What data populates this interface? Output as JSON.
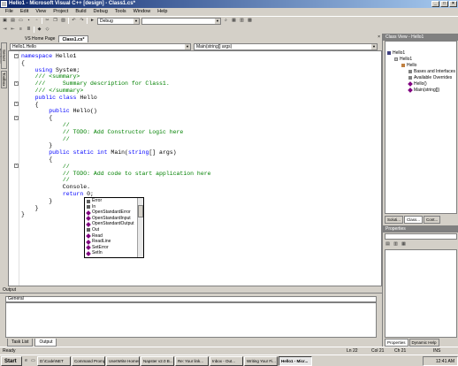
{
  "window": {
    "title": "Hello1 - Microsoft Visual C++ [design] - Class1.cs*",
    "min": "_",
    "max": "□",
    "close": "×"
  },
  "menu": [
    "File",
    "Edit",
    "View",
    "Project",
    "Build",
    "Debug",
    "Tools",
    "Window",
    "Help"
  ],
  "toolbar": {
    "config": "Debug"
  },
  "left_tabs": [
    "Server Explorer",
    "Toolbox"
  ],
  "doc_tabs": [
    {
      "label": "VS Home Page",
      "active": false
    },
    {
      "label": "Class1.cs*",
      "active": true
    }
  ],
  "nav": {
    "class": "Hello1.Hello",
    "member": "Main(string[] args)"
  },
  "code_lines": [
    [
      [
        "kw",
        "namespace"
      ],
      [
        "t",
        " Hello1"
      ]
    ],
    [
      [
        "t",
        "{"
      ]
    ],
    [
      [
        "t",
        "    "
      ],
      [
        "kw",
        "using"
      ],
      [
        "t",
        " System;"
      ]
    ],
    [
      [
        "t",
        ""
      ]
    ],
    [
      [
        "t",
        "    "
      ],
      [
        "cm",
        "/// <summary>"
      ]
    ],
    [
      [
        "t",
        "    "
      ],
      [
        "cm",
        "///     Summary description for Class1."
      ]
    ],
    [
      [
        "t",
        "    "
      ],
      [
        "cm",
        "/// </summary>"
      ]
    ],
    [
      [
        "t",
        "    "
      ],
      [
        "kw",
        "public class"
      ],
      [
        "t",
        " Hello"
      ]
    ],
    [
      [
        "t",
        "    {"
      ]
    ],
    [
      [
        "t",
        "        "
      ],
      [
        "kw",
        "public"
      ],
      [
        "t",
        " Hello()"
      ]
    ],
    [
      [
        "t",
        "        {"
      ]
    ],
    [
      [
        "t",
        "            "
      ],
      [
        "cm",
        "//"
      ]
    ],
    [
      [
        "t",
        "            "
      ],
      [
        "cm",
        "// TODO: Add Constructor Logic here"
      ]
    ],
    [
      [
        "t",
        "            "
      ],
      [
        "cm",
        "//"
      ]
    ],
    [
      [
        "t",
        "        }"
      ]
    ],
    [
      [
        "t",
        ""
      ]
    ],
    [
      [
        "t",
        "        "
      ],
      [
        "kw",
        "public static int"
      ],
      [
        "t",
        " Main("
      ],
      [
        "kw",
        "string"
      ],
      [
        "t",
        "[] args)"
      ]
    ],
    [
      [
        "t",
        "        {"
      ]
    ],
    [
      [
        "t",
        "            "
      ],
      [
        "cm",
        "//"
      ]
    ],
    [
      [
        "t",
        "            "
      ],
      [
        "cm",
        "// TODO: Add code to start application here"
      ]
    ],
    [
      [
        "t",
        "            "
      ],
      [
        "cm",
        "//"
      ]
    ],
    [
      [
        "t",
        "            Console."
      ]
    ],
    [
      [
        "t",
        "            "
      ],
      [
        "kw",
        "return"
      ],
      [
        "t",
        " 0;"
      ]
    ],
    [
      [
        "t",
        "        }"
      ]
    ],
    [
      [
        "t",
        "    }"
      ]
    ],
    [
      [
        "t",
        "}"
      ]
    ]
  ],
  "autocomplete": [
    {
      "label": "Error",
      "kind": "prop"
    },
    {
      "label": "In",
      "kind": "prop"
    },
    {
      "label": "OpenStandardError",
      "kind": "method"
    },
    {
      "label": "OpenStandardInput",
      "kind": "method"
    },
    {
      "label": "OpenStandardOutput",
      "kind": "method"
    },
    {
      "label": "Out",
      "kind": "prop"
    },
    {
      "label": "Read",
      "kind": "method"
    },
    {
      "label": "ReadLine",
      "kind": "method"
    },
    {
      "label": "SetError",
      "kind": "method"
    },
    {
      "label": "SetIn",
      "kind": "method"
    }
  ],
  "output": {
    "title": "Output",
    "pane": "General"
  },
  "bottom_tabs": [
    "Task List",
    "Output"
  ],
  "class_view": {
    "title": "Class View - Hello1",
    "items": [
      "Hello1",
      "Hello1",
      "Hello",
      "Bases and Interfaces",
      "Available Overrides",
      "Hello()",
      "Main(string[])"
    ]
  },
  "right_tabs": [
    "Soluti...",
    "Class...",
    "Cont..."
  ],
  "properties": {
    "title": "Properties"
  },
  "right_bottom_tabs": [
    "Properties",
    "Dynamic Help"
  ],
  "status": {
    "text": "Ready",
    "ln": "Ln 22",
    "col": "Col 21",
    "ch": "Ch 21",
    "mode": "INS"
  },
  "taskbar": {
    "start": "Start",
    "items": [
      {
        "label": "D:\\Code\\NET",
        "active": false
      },
      {
        "label": "Command Prompt",
        "active": false
      },
      {
        "label": "UserWrite Homes...",
        "active": false
      },
      {
        "label": "Napster v2.0 B...",
        "active": false
      },
      {
        "label": "Re: Your link...",
        "active": false
      },
      {
        "label": "Inbox - Out...",
        "active": false
      },
      {
        "label": "Writing Your Fi...",
        "active": false
      },
      {
        "label": "Hello1 - Micr...",
        "active": true
      }
    ],
    "clock": "12:41 AM"
  }
}
